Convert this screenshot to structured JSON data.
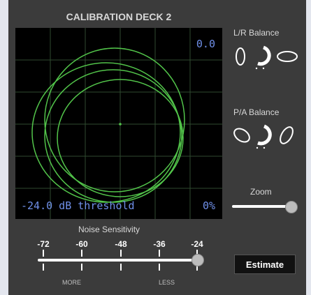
{
  "deck": {
    "title": "CALIBRATION DECK 2"
  },
  "scope": {
    "level_top": "0.0",
    "threshold_text": "-24.0 dB threshold",
    "percent": "0%",
    "trace_color": "#52c44a",
    "grid_color": "#2f4a2f",
    "readout_color": "#6f8fe8"
  },
  "balances": {
    "lr": {
      "label": "L/R Balance"
    },
    "pa": {
      "label": "P/A Balance"
    }
  },
  "zoom": {
    "label": "Zoom",
    "value": 1.0
  },
  "noise": {
    "label": "Noise Sensitivity",
    "ticks": [
      "-72",
      "-60",
      "-48",
      "-36",
      "-24"
    ],
    "selected": "-24",
    "left_hint": "MORE",
    "right_hint": "LESS"
  },
  "actions": {
    "estimate": "Estimate"
  }
}
